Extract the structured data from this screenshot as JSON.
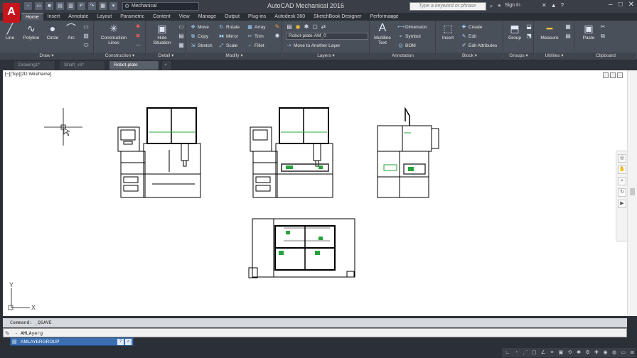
{
  "app": {
    "logo": "A",
    "title": "AutoCAD Mechanical 2016",
    "workspace": "Mechanical",
    "search_placeholder": "Type a keyword or phrase",
    "sign_in": "Sign In"
  },
  "ribbon_tabs": [
    "Home",
    "Insert",
    "Annotate",
    "Layout",
    "Parametric",
    "Content",
    "View",
    "Manage",
    "Output",
    "Plug-ins",
    "Autodesk 360",
    "SketchBook Designer",
    "Performance"
  ],
  "ribbon": {
    "draw": {
      "title": "Draw ▾",
      "line": "Line",
      "polyline": "Polyline",
      "circle": "Circle",
      "arc": "Arc"
    },
    "construction": {
      "title": "Construction ▾",
      "lines": "Construction Lines"
    },
    "detail": {
      "title": "Detail ▾",
      "hide": "Hide Situation"
    },
    "modify": {
      "title": "Modify ▾",
      "move": "Move",
      "rotate": "Rotate",
      "array": "Array",
      "copy": "Copy",
      "mirror": "Mirror",
      "trim": "Trim",
      "stretch": "Stretch",
      "scale": "Scale",
      "fillet": "Fillet"
    },
    "layers": {
      "title": "Layers ▾",
      "current_layer": "Robot-plate-AM_0",
      "move_to_layer": "Move to Another Layer"
    },
    "annotation": {
      "title": "Annotation",
      "multiline": "Multiline Text",
      "dimension": "Dimension",
      "symbol": "Symbol",
      "bom": "BOM"
    },
    "block": {
      "title": "Block ▾",
      "insert": "Insert",
      "create": "Create",
      "edit": "Edit",
      "edit_attributes": "Edit Attributes"
    },
    "groups": {
      "title": "Groups ▾",
      "group": "Group"
    },
    "utilities": {
      "title": "Utilities ▾",
      "measure": "Measure"
    },
    "clipboard": {
      "title": "Clipboard",
      "paste": "Paste"
    }
  },
  "doc_tabs": [
    "Drawing1*",
    "Shaft_v3*",
    "Robot-plate",
    "+"
  ],
  "viewport": {
    "label": "[−][Top][2D Wireframe]",
    "ucs_x": "X",
    "ucs_y": "Y"
  },
  "command": {
    "history": "Command:  _QSAVE",
    "input_value": "- AMLAyerg",
    "suggestion": "AMLAYERGROUP"
  }
}
